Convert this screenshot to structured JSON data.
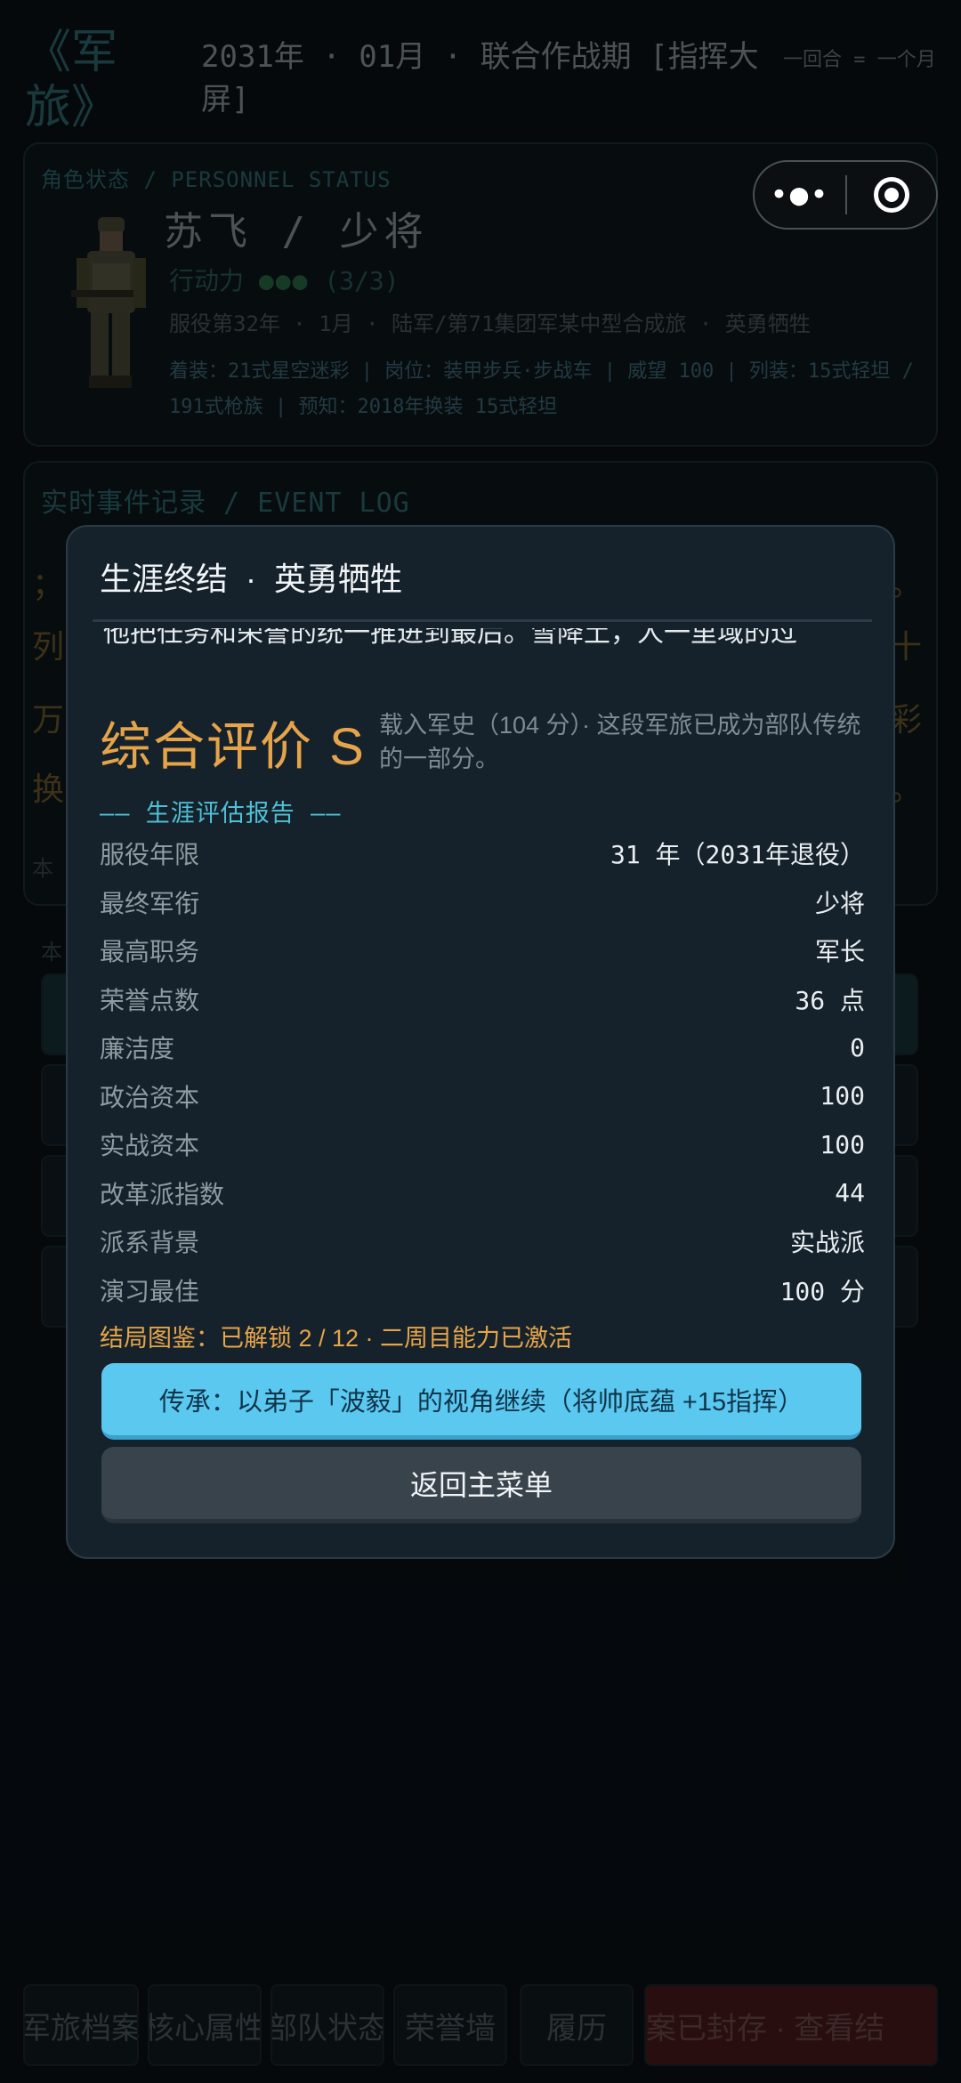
{
  "header": {
    "app_title": "《军旅》",
    "date_line": "2031年 · 01月 · 联合作战期 [指挥大屏]",
    "turn_note": "一回合 = 一个月"
  },
  "status_panel": {
    "label": "角色状态 / PERSONNEL STATUS",
    "name_rank": "苏飞  /  少将",
    "action_label": "行动力",
    "action_dots": "●●●",
    "action_count": "(3/3)",
    "service_line": "服役第32年 · 1月 · 陆军/第71集团军某中型合成旅 · 英勇牺牲",
    "gear_line": "着装：21式星空迷彩 | 岗位：装甲步兵·步战车 | 威望 100 | 列装：15式轻坦 / 191式枪族 | 预知：2018年换装 15式轻坦"
  },
  "log_panel": {
    "label": "实时事件记录 / EVENT LOG",
    "fragments": [
      "；",
      "列",
      "万",
      "换",
      "本",
      "本"
    ],
    "right_fragments": [
      "。",
      "十",
      "彩",
      "。"
    ]
  },
  "capsule": {
    "more_icon": "more-icon",
    "close_icon": "close-target-icon"
  },
  "modal": {
    "title": "生涯终结  ·  英勇牺牲",
    "cut_text": "他把任务和荣誉的统一推进到最后。雪降土，人一里域的过",
    "grade": "综合评价 S",
    "grade_note": "载入军史（104 分）· 这段军旅已成为部队传统的一部分。",
    "report_head": "—— 生涯评估报告 ——",
    "stats": [
      {
        "key": "服役年限",
        "value": "31 年（2031年退役）"
      },
      {
        "key": "最终军衔",
        "value": "少将"
      },
      {
        "key": "最高职务",
        "value": "军长"
      },
      {
        "key": "荣誉点数",
        "value": "36 点"
      },
      {
        "key": "廉洁度",
        "value": "0"
      },
      {
        "key": "政治资本",
        "value": "100"
      },
      {
        "key": "实战资本",
        "value": "100"
      },
      {
        "key": "改革派指数",
        "value": "44"
      },
      {
        "key": "派系背景",
        "value": "实战派"
      },
      {
        "key": "演习最佳",
        "value": "100 分"
      }
    ],
    "endings": "结局图鉴：已解锁 2 / 12 · 二周目能力已激活",
    "inherit_button": "传承：以弟子「波毅」的视角继续（将帅底蕴 +15指挥）",
    "menu_button": "返回主菜单"
  },
  "bottom_nav": {
    "items": [
      "军旅档案",
      "核心属性",
      "部队状态",
      "荣誉墙",
      "履历",
      "案已封存 · 查看结"
    ]
  },
  "colors": {
    "accent_gold": "#e6a44a",
    "accent_cyan": "#4fc0d6",
    "primary_button": "#5bc8f0",
    "danger": "#4a1a1c"
  }
}
